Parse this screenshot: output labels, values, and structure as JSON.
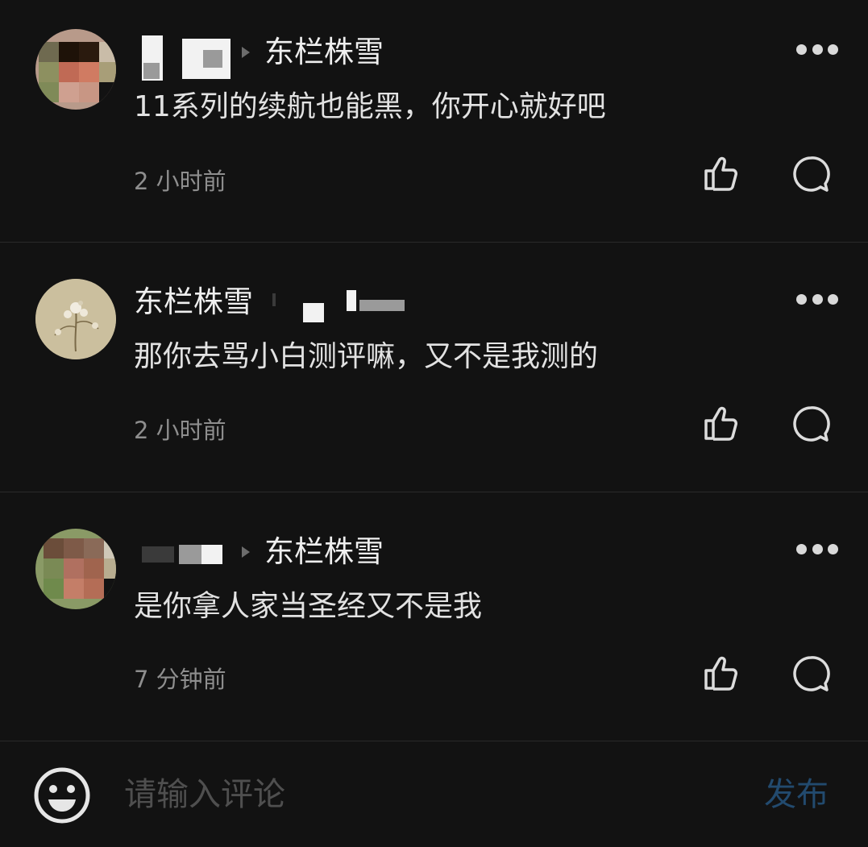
{
  "comments": [
    {
      "author": "",
      "reply_to": "东栏株雪",
      "text": "11系列的续航也能黑，你开心就好吧",
      "time": "2 小时前"
    },
    {
      "author": "东栏株雪",
      "reply_to": "",
      "text": "那你去骂小白测评嘛，又不是我测的",
      "time": "2 小时前"
    },
    {
      "author": "",
      "reply_to": "东栏株雪",
      "text": "是你拿人家当圣经又不是我",
      "time": "7 分钟前"
    }
  ],
  "icons": {
    "more": "more-icon",
    "like": "thumbs-up-icon",
    "reply": "chat-bubble-icon",
    "emoji": "smiley-icon",
    "reply_arrow": "arrow-right-icon"
  },
  "composer": {
    "placeholder": "请输入评论",
    "publish_label": "发布"
  },
  "colors": {
    "background": "#121212",
    "divider": "#2a2a2a",
    "publish_disabled": "#224a6e",
    "time_text": "#8e8e8e"
  }
}
